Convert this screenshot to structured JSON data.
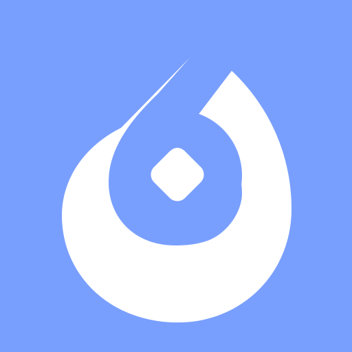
{
  "icon": {
    "name": "stylized-six-logo-icon",
    "colors": {
      "background": "#799ffe",
      "foreground": "#ffffff",
      "inner": "#799ffe"
    }
  }
}
